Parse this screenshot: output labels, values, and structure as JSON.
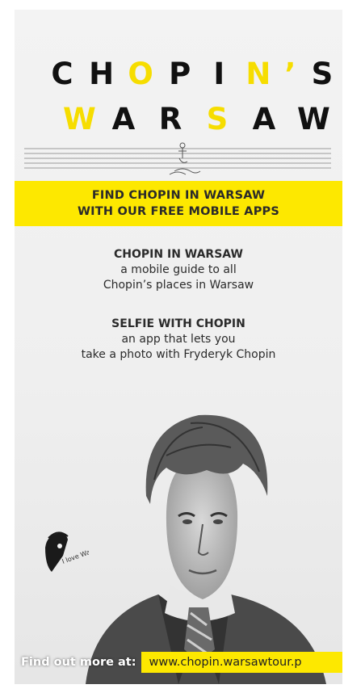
{
  "title": {
    "line1": [
      "C",
      "H",
      "O",
      "P",
      "I",
      "N",
      "’",
      "S"
    ],
    "line2": [
      "W",
      "A",
      "R",
      "S",
      "A",
      "W"
    ]
  },
  "banner": {
    "line1": "FIND CHOPIN IN WARSAW",
    "line2": "WITH OUR FREE MOBILE APPS"
  },
  "apps": [
    {
      "name": "CHOPIN IN WARSAW",
      "line1": "a mobile guide to all",
      "line2": "Chopin’s places in Warsaw"
    },
    {
      "name": "SELFIE WITH CHOPIN",
      "line1": "an app that lets you",
      "line2": "take a photo with Fryderyk Chopin"
    }
  ],
  "stamp_text": "I love Warsaw",
  "footer": {
    "lead": "Find out more at:",
    "url": "www.chopin.warsawtour.p"
  },
  "colors": {
    "brand_yellow": "#fde800",
    "title_yellow": "#f6dd00",
    "ink": "#111111"
  }
}
